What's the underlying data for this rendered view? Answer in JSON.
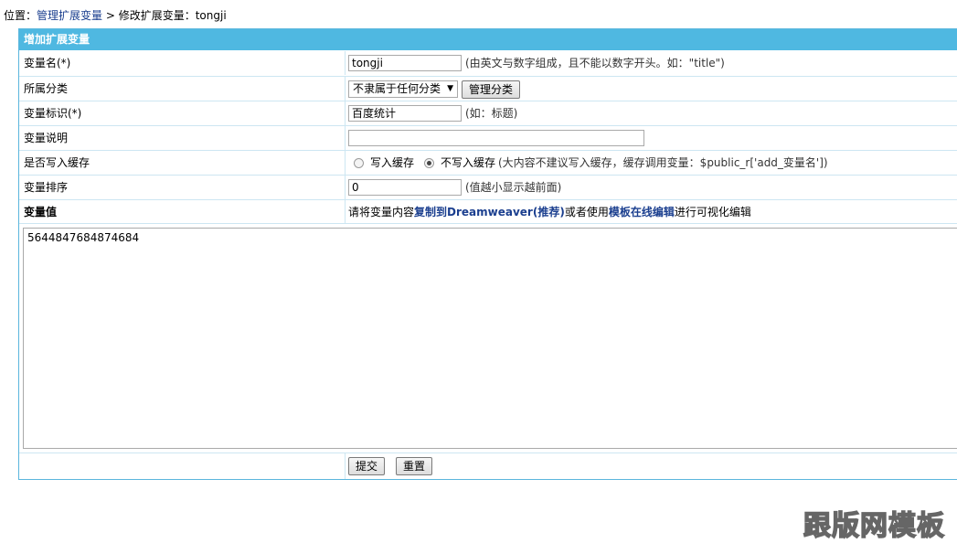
{
  "breadcrumb": {
    "prefix": "位置：",
    "link": "管理扩展变量",
    "sep": " > ",
    "current": "修改扩展变量：tongji"
  },
  "form": {
    "header": "增加扩展变量",
    "var_name": {
      "label": "变量名(*)",
      "value": "tongji",
      "hint": "(由英文与数字组成，且不能以数字开头。如：\"title\")"
    },
    "category": {
      "label": "所属分类",
      "selected": "不隶属于任何分类",
      "manage_button": "管理分类"
    },
    "var_title": {
      "label": "变量标识(*)",
      "value": "百度统计",
      "hint": "(如：标题)"
    },
    "description": {
      "label": "变量说明",
      "value": ""
    },
    "cache": {
      "label": "是否写入缓存",
      "opt1": "写入缓存",
      "opt2": "不写入缓存",
      "selected": "opt2",
      "hint": "(大内容不建议写入缓存，缓存调用变量：$public_r['add_变量名'])"
    },
    "order": {
      "label": "变量排序",
      "value": "0",
      "hint": "(值越小显示越前面)"
    },
    "value_row": {
      "label": "变量值",
      "text1": "请将变量内容",
      "link1": "复制到Dreamweaver(推荐)",
      "text2": "或者使用",
      "link2": "模板在线编辑",
      "text3": "进行可视化编辑"
    },
    "content": "5644847684874684",
    "submit": "提交",
    "reset": "重置"
  },
  "watermark": "跟版网模板"
}
